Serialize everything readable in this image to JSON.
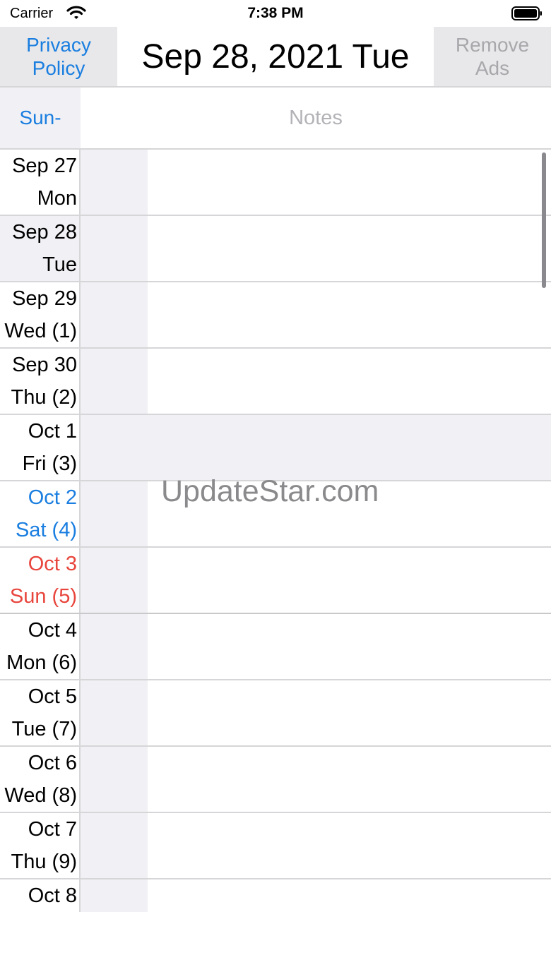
{
  "status_bar": {
    "carrier": "Carrier",
    "time": "7:38 PM"
  },
  "header": {
    "privacy_button": "Privacy Policy",
    "title": "Sep 28, 2021 Tue",
    "remove_ads_button": "Remove Ads"
  },
  "subheader": {
    "week_start_button": "Sun-",
    "notes_label": "Notes"
  },
  "days": [
    {
      "date": "Sep 27",
      "weekday": "Mon"
    },
    {
      "date": "Sep 28",
      "weekday": "Tue"
    },
    {
      "date": "Sep 29",
      "weekday": "Wed (1)"
    },
    {
      "date": "Sep 30",
      "weekday": "Thu (2)"
    },
    {
      "date": "Oct 1",
      "weekday": "Fri (3)"
    },
    {
      "date": "Oct 2",
      "weekday": "Sat (4)"
    },
    {
      "date": "Oct 3",
      "weekday": "Sun (5)"
    },
    {
      "date": "Oct 4",
      "weekday": "Mon (6)"
    },
    {
      "date": "Oct 5",
      "weekday": "Tue (7)"
    },
    {
      "date": "Oct 6",
      "weekday": "Wed (8)"
    },
    {
      "date": "Oct 7",
      "weekday": "Thu (9)"
    },
    {
      "date": "Oct 8",
      "weekday": ""
    }
  ],
  "watermark": "UpdateStar.com",
  "colors": {
    "accent_blue": "#1a7ee0",
    "sunday_red": "#e8453c",
    "disabled_gray": "#a8a8ac"
  }
}
